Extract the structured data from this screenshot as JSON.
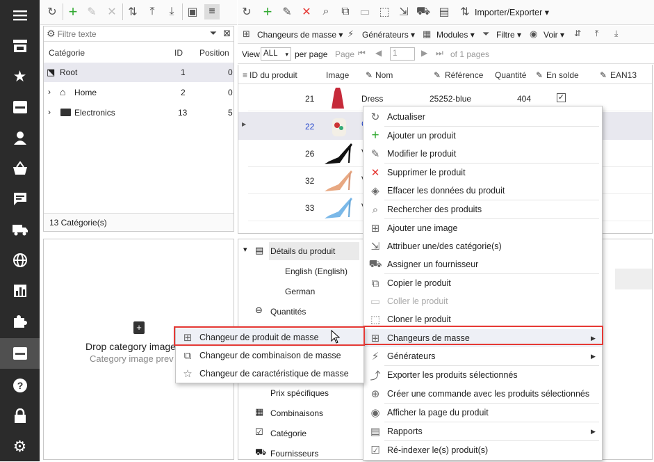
{
  "left_toolbar": {
    "filter_placeholder": "Filtre texte"
  },
  "category_grid": {
    "columns": [
      "Catégorie",
      "ID",
      "Position"
    ],
    "rows": [
      {
        "name": "Root",
        "id": "1",
        "position": "0"
      },
      {
        "name": "Home",
        "id": "2",
        "position": "0"
      },
      {
        "name": "Electronics",
        "id": "13",
        "position": "5"
      }
    ],
    "footer": "13 Catégorie(s)"
  },
  "image_drop": {
    "title": "Drop category image",
    "subtitle": "Category image prev"
  },
  "top_toolbar": {
    "import_export": "Importer/Exporter"
  },
  "second_toolbar": {
    "mass_changers": "Changeurs de masse",
    "generators": "Générateurs",
    "modules": "Modules",
    "filter": "Filtre",
    "view": "Voir"
  },
  "pager": {
    "view_label": "View",
    "view_value": "ALL",
    "per_page": "per page",
    "page_label": "Page",
    "page_value": "1",
    "of_pages": "of 1 pages"
  },
  "product_grid": {
    "columns": [
      "ID du produit",
      "Image",
      "Nom",
      "Référence",
      "Quantité",
      "En solde",
      "EAN13"
    ],
    "rows": [
      {
        "id": "21",
        "name": "Dress",
        "ref": "25252-blue",
        "qty": "404",
        "on_sale": true
      },
      {
        "id": "22",
        "name": "C",
        "ref": "",
        "qty": "",
        "on_sale": false
      },
      {
        "id": "26",
        "name": "V",
        "ref": "",
        "qty": "",
        "on_sale": false
      },
      {
        "id": "32",
        "name": "V",
        "ref": "",
        "qty": "",
        "on_sale": false
      },
      {
        "id": "33",
        "name": "V",
        "ref": "",
        "qty": "",
        "on_sale": false
      }
    ]
  },
  "details_tree": {
    "product_details": "Détails du produit",
    "english": "English (English)",
    "german": "German",
    "quantities": "Quantités",
    "specific_prices": "Prix spécifiques",
    "combinations": "Combinaisons",
    "category": "Catégorie",
    "suppliers": "Fournisseurs"
  },
  "context_menu": {
    "items": [
      {
        "label": "Actualiser",
        "icon": "refresh-icon"
      },
      {
        "label": "Ajouter un produit",
        "icon": "plus-icon"
      },
      {
        "label": "Modifier le produit",
        "icon": "pencil-icon"
      },
      {
        "label": "Supprimer le produit",
        "icon": "delete-icon"
      },
      {
        "label": "Effacer les données du produit",
        "icon": "eraser-icon"
      },
      {
        "label": "Rechercher des produits",
        "icon": "search-icon"
      },
      {
        "label": "Ajouter une image",
        "icon": "add-image-icon"
      },
      {
        "label": "Attribuer une/des catégorie(s)",
        "icon": "assign-category-icon"
      },
      {
        "label": "Assigner un fournisseur",
        "icon": "truck-icon"
      },
      {
        "label": "Copier le produit",
        "icon": "copy-icon"
      },
      {
        "label": "Coller le produit",
        "icon": "paste-icon"
      },
      {
        "label": "Cloner le produit",
        "icon": "clone-icon"
      },
      {
        "label": "Changeurs de masse",
        "icon": "mass-change-icon"
      },
      {
        "label": "Générateurs",
        "icon": "lightning-icon"
      },
      {
        "label": "Exporter les produits sélectionnés",
        "icon": "export-icon"
      },
      {
        "label": "Créer une commande avec les produits sélectionnés",
        "icon": "order-icon"
      },
      {
        "label": "Afficher la page du produit",
        "icon": "eye-icon"
      },
      {
        "label": "Rapports",
        "icon": "report-icon"
      },
      {
        "label": "Ré-indexer le(s) produit(s)",
        "icon": "reindex-icon"
      }
    ]
  },
  "submenu": {
    "items": [
      {
        "label": "Changeur de produit de masse",
        "icon": "product-mass-icon"
      },
      {
        "label": "Changeur de combinaison de masse",
        "icon": "combination-mass-icon"
      },
      {
        "label": "Changeur de caractéristique de masse",
        "icon": "feature-mass-icon"
      }
    ]
  },
  "colors": {
    "highlight": "#e53935",
    "sidebar": "#2b2b2b",
    "link_blue": "#2244cc"
  }
}
